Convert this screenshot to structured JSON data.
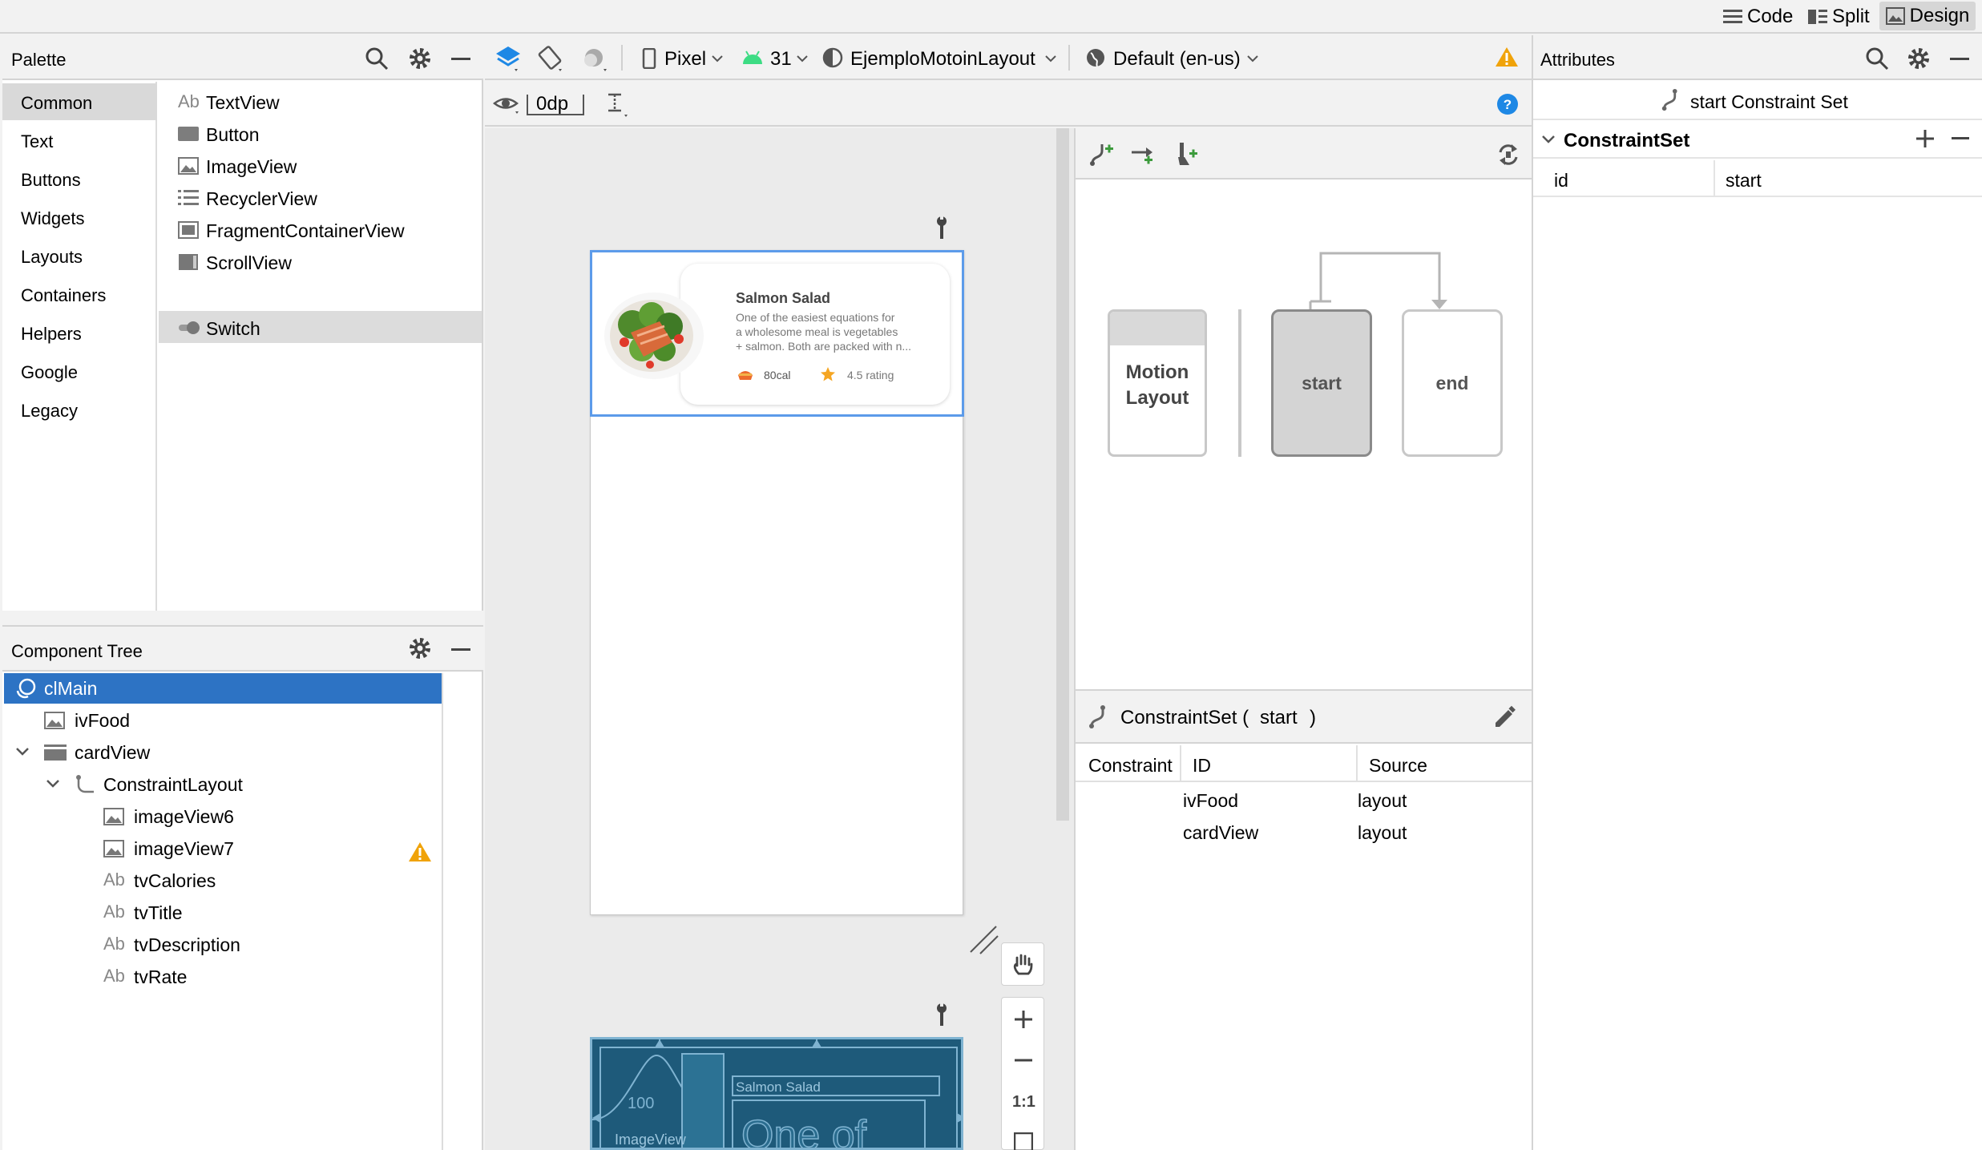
{
  "topbar": {
    "code": "Code",
    "split": "Split",
    "design": "Design"
  },
  "palette": {
    "title": "Palette",
    "categories": [
      "Common",
      "Text",
      "Buttons",
      "Widgets",
      "Layouts",
      "Containers",
      "Helpers",
      "Google",
      "Legacy"
    ],
    "items": [
      {
        "icon": "text-icon",
        "label": "TextView",
        "glyph": "Ab"
      },
      {
        "icon": "button-icon",
        "label": "Button"
      },
      {
        "icon": "image-icon",
        "label": "ImageView"
      },
      {
        "icon": "list-icon",
        "label": "RecyclerView"
      },
      {
        "icon": "fragment-icon",
        "label": "FragmentContainerView"
      },
      {
        "icon": "scroll-icon",
        "label": "ScrollView"
      },
      {
        "icon": "switch-icon",
        "label": "Switch"
      }
    ]
  },
  "tree": {
    "title": "Component Tree",
    "nodes": [
      {
        "label": "clMain"
      },
      {
        "label": "ivFood"
      },
      {
        "label": "cardView"
      },
      {
        "label": "ConstraintLayout"
      },
      {
        "label": "imageView6"
      },
      {
        "label": "imageView7"
      },
      {
        "label": "tvCalories",
        "glyph": "Ab"
      },
      {
        "label": "tvTitle",
        "glyph": "Ab"
      },
      {
        "label": "tvDescription",
        "glyph": "Ab"
      },
      {
        "label": "tvRate",
        "glyph": "Ab"
      }
    ]
  },
  "toolbar": {
    "device": "Pixel",
    "api": "31",
    "theme": "EjemploMotoinLayout",
    "locale": "Default (en-us)",
    "margin": "0dp"
  },
  "preview": {
    "title": "Salmon Salad",
    "desc_line1": "One of the easiest equations for",
    "desc_line2": "a wholesome meal is vegetables",
    "desc_line3": "+ salmon. Both are packed with n...",
    "calories": "80cal",
    "rating": "4.5 rating",
    "blueprint_title": "Salmon Salad",
    "blueprint_dim": "100",
    "blueprint_image": "ImageView",
    "blueprint_text": "One of"
  },
  "zoom": {
    "one_to_one": "1:1"
  },
  "motion": {
    "layout_line1": "Motion",
    "layout_line2": "Layout",
    "start": "start",
    "end": "end"
  },
  "constraintset": {
    "header": "ConstraintSet (",
    "id": "start",
    "close": ")",
    "columns": [
      "Constraint",
      "ID",
      "Source"
    ],
    "rows": [
      {
        "id": "ivFood",
        "source": "layout"
      },
      {
        "id": "cardView",
        "source": "layout"
      }
    ]
  },
  "attributes": {
    "title": "Attributes",
    "subtitle": "start Constraint Set",
    "section": "ConstraintSet",
    "id_label": "id",
    "id_value": "start"
  },
  "colors": {
    "selection": "#2d73c4",
    "accent_blue": "#1e88e5",
    "warning": "#f0a30a",
    "canvas": "#ebebeb",
    "blueprint": "#1e5a7a"
  }
}
